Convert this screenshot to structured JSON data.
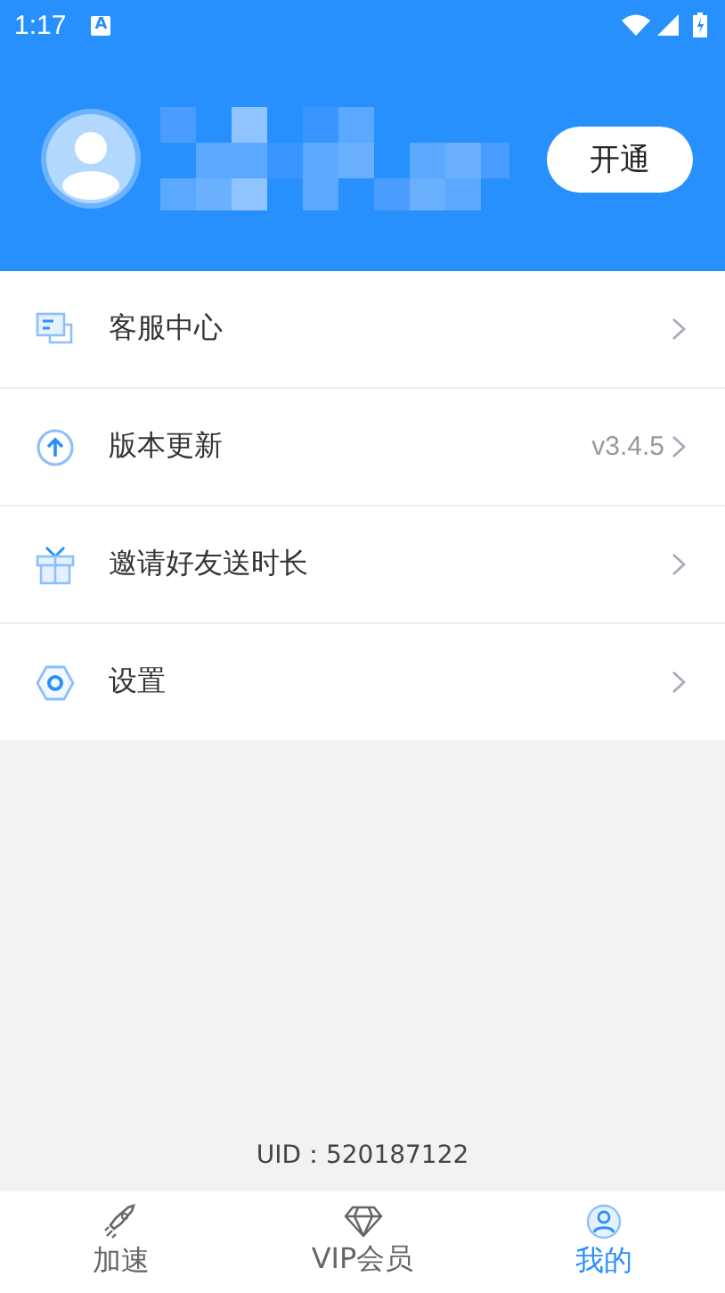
{
  "status_bar": {
    "time": "1:17",
    "notification": "A"
  },
  "header": {
    "button": "开通"
  },
  "menu": [
    {
      "label": "客服中心"
    },
    {
      "label": "版本更新",
      "value": "v3.4.5"
    },
    {
      "label": "邀请好友送时长"
    },
    {
      "label": "设置"
    }
  ],
  "uid": "UID：520187122",
  "tabs": [
    {
      "label": "加速",
      "selected": false
    },
    {
      "label": "VIP会员",
      "selected": false
    },
    {
      "label": "我的",
      "selected": true
    }
  ]
}
